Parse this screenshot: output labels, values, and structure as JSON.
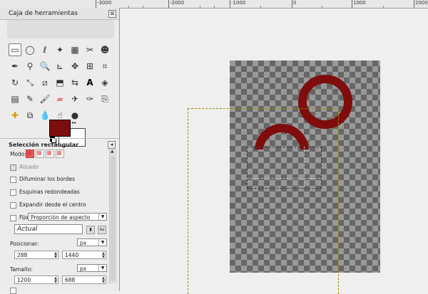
{
  "ruler": {
    "labels": [
      "-3000",
      "-2000",
      "-1000",
      "0",
      "1000",
      "2000"
    ]
  },
  "toolbox": {
    "title": "Caja de herramientas",
    "tool_icons": [
      "rect-select-icon",
      "ellipse-select-icon",
      "lasso-icon",
      "fuzzy-select-icon",
      "color-select-icon",
      "scissors-icon",
      "foreground-select-icon",
      "paths-icon",
      "color-picker-icon",
      "magnify-icon",
      "measure-icon",
      "move-icon",
      "align-icon",
      "crop-icon",
      "rotate-icon",
      "scale-icon",
      "shear-icon",
      "perspective-icon",
      "flip-icon",
      "text-icon",
      "bucket-fill-icon",
      "blend-icon",
      "pencil-icon",
      "paintbrush-icon",
      "eraser-icon",
      "airbrush-icon",
      "ink-icon",
      "clone-icon",
      "heal-icon",
      "perspective-clone-icon",
      "blur-icon",
      "smudge-icon",
      "dodge-icon"
    ],
    "colors": {
      "foreground": "#7f0d0d",
      "background": "#ffffff"
    }
  },
  "options": {
    "title": "Selección rectangular",
    "mode_label": "Modo:",
    "antialias_label": "Alisado",
    "feather_label": "Difuminar los bordes",
    "rounded_label": "Esquinas redondeadas",
    "expand_label": "Expandir desde el centro",
    "fixed_label": "Fijo:",
    "fixed_option": "Proporción de aspecto",
    "current_value": "Actual",
    "position_label": "Posicionar:",
    "position_unit": "px",
    "position_x": "288",
    "position_y": "1440",
    "size_label": "Tamaño:",
    "size_unit": "px",
    "size_w": "1200",
    "size_h": "688"
  }
}
